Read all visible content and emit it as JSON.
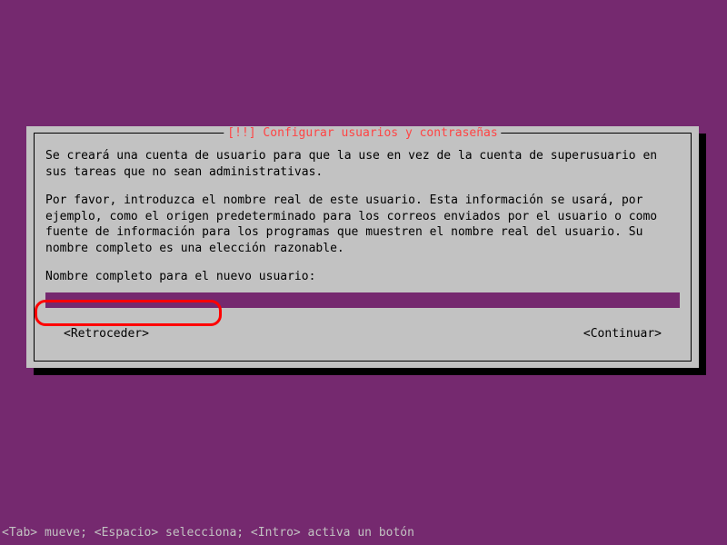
{
  "dialog": {
    "title": "[!!] Configurar usuarios y contraseñas",
    "paragraph1": "Se creará una cuenta de usuario para que la use en vez de la cuenta de superusuario en sus tareas que no sean administrativas.",
    "paragraph2": "Por favor, introduzca el nombre real de este usuario. Esta información se usará, por ejemplo, como el origen predeterminado para los correos enviados por el usuario o como fuente de información para los programas que muestren el nombre real del usuario. Su nombre completo es una elección razonable.",
    "prompt_label": "Nombre completo para el nuevo usuario:",
    "input_value": "",
    "buttons": {
      "back": "<Retroceder>",
      "continue": "<Continuar>"
    }
  },
  "footer": {
    "hint": "<Tab> mueve; <Espacio> selecciona; <Intro> activa un botón"
  },
  "colors": {
    "background": "#75296f",
    "dialog_bg": "#c2c2c2",
    "title_color": "#ff4444",
    "highlight": "#ff0000"
  }
}
